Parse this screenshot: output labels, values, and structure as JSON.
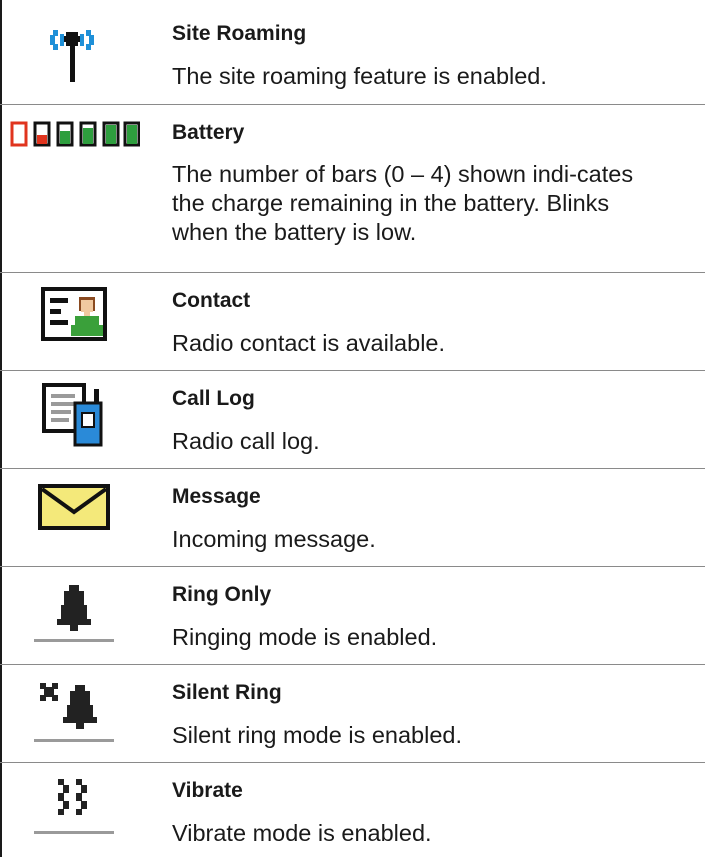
{
  "rows": [
    {
      "title": "Site Roaming",
      "description": "The site roaming feature is enabled.",
      "icon": "site-roaming-icon"
    },
    {
      "title": "Battery",
      "description": "The number of bars (0 – 4) shown indi-cates the charge remaining in the battery. Blinks when the battery is low.",
      "icon": "battery-icon"
    },
    {
      "title": "Contact",
      "description": "Radio contact is available.",
      "icon": "contact-icon"
    },
    {
      "title": "Call Log",
      "description": "Radio call log.",
      "icon": "call-log-icon"
    },
    {
      "title": "Message",
      "description": "Incoming message.",
      "icon": "message-icon"
    },
    {
      "title": "Ring Only",
      "description": "Ringing mode is enabled.",
      "icon": "ring-only-icon"
    },
    {
      "title": "Silent Ring",
      "description": "Silent ring mode is enabled.",
      "icon": "silent-ring-icon"
    },
    {
      "title": "Vibrate",
      "description": "Vibrate mode is enabled.",
      "icon": "vibrate-icon"
    }
  ],
  "colors": {
    "roaming_blue": "#1e90d8",
    "battery_red": "#e0341e",
    "battery_green": "#2e9e3e",
    "contact_brown": "#8a4a20",
    "contact_green": "#3aa03a",
    "calllog_blue": "#2a8ad8",
    "message_yellow": "#f4e97a",
    "rule_gray": "#9a9a9a"
  }
}
